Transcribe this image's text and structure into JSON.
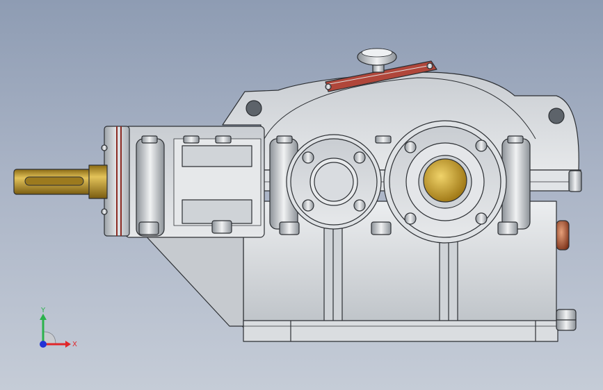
{
  "viewport": {
    "model": "gear-reducer-assembly",
    "background_top": "#8e9cb3",
    "background_bottom": "#c5ccd7"
  },
  "colors": {
    "housing": "#d6d9dc",
    "housing_shade": "#b9bec4",
    "edge": "#2c2f33",
    "brass": "#c9a032",
    "seal_red": "#8a2a22"
  },
  "triad": {
    "x_label": "X",
    "y_label": "Y",
    "x_color": "#e0262a",
    "y_color": "#2bb24c",
    "z_color": "#2233d6"
  }
}
